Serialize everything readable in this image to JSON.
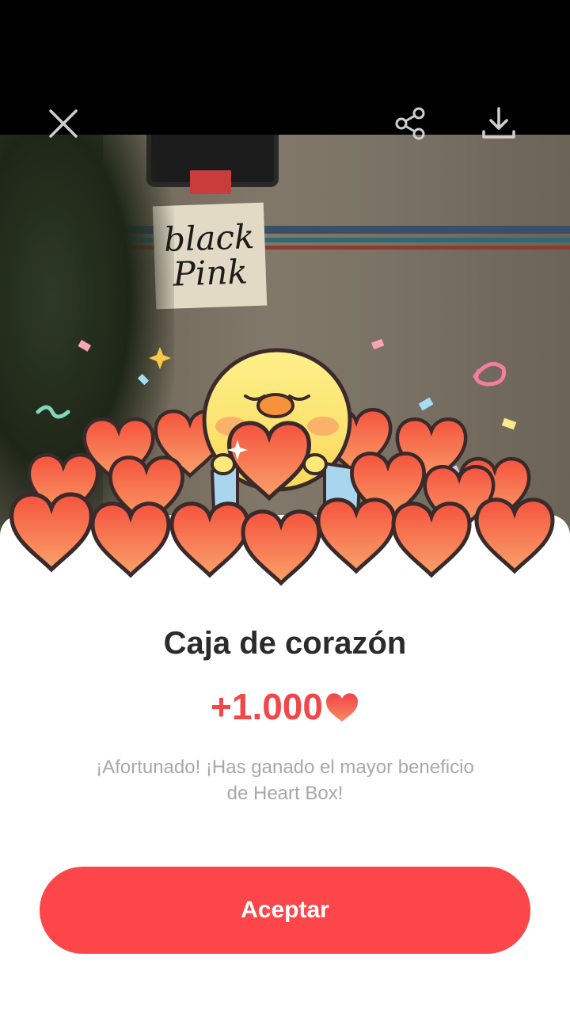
{
  "photo": {
    "sign_line1": "black",
    "sign_line2": "Pink"
  },
  "toolbar": {
    "close_icon": "close-icon",
    "share_icon": "share-icon",
    "download_icon": "download-icon"
  },
  "dialog": {
    "title": "Caja de corazón",
    "reward_amount": "+1.000",
    "reward_icon": "heart-icon",
    "description": "¡Afortunado! ¡Has ganado el mayor beneficio de Heart Box!",
    "accept_label": "Aceptar"
  },
  "colors": {
    "accent": "#fd4649",
    "reward_text": "#f2474a",
    "heart_fill": "#f25a44",
    "chick_fill": "#fde977"
  }
}
